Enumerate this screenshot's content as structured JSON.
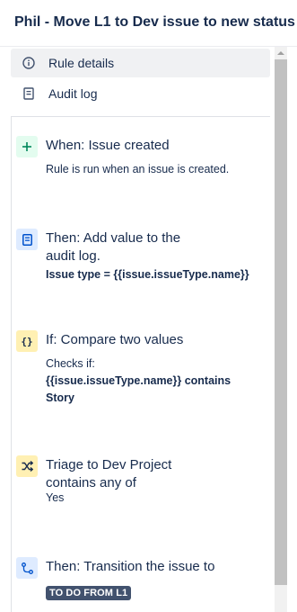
{
  "header": {
    "title": "Phil - Move L1 to Dev issue to new status"
  },
  "nav": {
    "items": [
      {
        "label": "Rule details",
        "icon": "info-icon",
        "active": true
      },
      {
        "label": "Audit log",
        "icon": "audit-log-icon",
        "active": false
      }
    ]
  },
  "steps": [
    {
      "icon": "plus-icon",
      "heading": "When: Issue created",
      "desc": "Rule is run when an issue is created."
    },
    {
      "icon": "audit-doc-icon",
      "heading": "Then: Add value to the audit log.",
      "desc_bold": "Issue type",
      "desc_rest": " = {{issue.issueType.name}}"
    },
    {
      "icon": "braces-icon",
      "heading": "If: Compare two values",
      "desc_line1": "Checks if:",
      "desc_bold": "{{issue.issueType.name}} contains Story"
    },
    {
      "icon": "shuffle-icon",
      "heading": "Triage to Dev Project contains any of",
      "desc": "Yes"
    },
    {
      "icon": "transition-icon",
      "heading": "Then: Transition the issue to",
      "lozenge": "TO DO FROM L1"
    }
  ],
  "colors": {
    "green_bg": "#e3fcef",
    "blue_bg": "#deebff",
    "yellow_bg": "#fff0b3",
    "lozenge": "#42526e"
  }
}
